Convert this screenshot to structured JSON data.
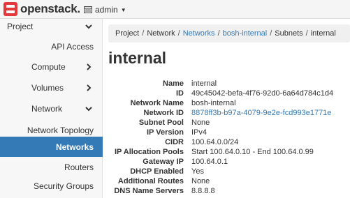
{
  "navbar": {
    "logo_text": "openstack.",
    "project_name": "admin"
  },
  "sidebar": {
    "items": [
      {
        "label": "Project"
      },
      {
        "label": "API Access"
      },
      {
        "label": "Compute"
      },
      {
        "label": "Volumes"
      },
      {
        "label": "Network"
      },
      {
        "label": "Network Topology"
      },
      {
        "label": "Networks"
      },
      {
        "label": "Routers"
      },
      {
        "label": "Security Groups"
      }
    ]
  },
  "breadcrumb": [
    "Project",
    "Network",
    "Networks",
    "bosh-internal",
    "Subnets",
    "internal"
  ],
  "page": {
    "title": "internal"
  },
  "details": [
    {
      "label": "Name",
      "value": "internal"
    },
    {
      "label": "ID",
      "value": "49c45042-befa-4f76-92d0-6a64d784c1d4"
    },
    {
      "label": "Network Name",
      "value": "bosh-internal"
    },
    {
      "label": "Network ID",
      "value": "8878ff3b-b97a-4079-9e2e-fcd993e1771e"
    },
    {
      "label": "Subnet Pool",
      "value": "None"
    },
    {
      "label": "IP Version",
      "value": "IPv4"
    },
    {
      "label": "CIDR",
      "value": "100.64.0.0/24"
    },
    {
      "label": "IP Allocation Pools",
      "value": "Start 100.64.0.10 - End 100.64.0.99"
    },
    {
      "label": "Gateway IP",
      "value": "100.64.0.1"
    },
    {
      "label": "DHCP Enabled",
      "value": "Yes"
    },
    {
      "label": "Additional Routes",
      "value": "None"
    },
    {
      "label": "DNS Name Servers",
      "value": "8.8.8.8"
    }
  ],
  "colors": {
    "accent": "#337ab7",
    "logo_red": "#e4393c"
  }
}
